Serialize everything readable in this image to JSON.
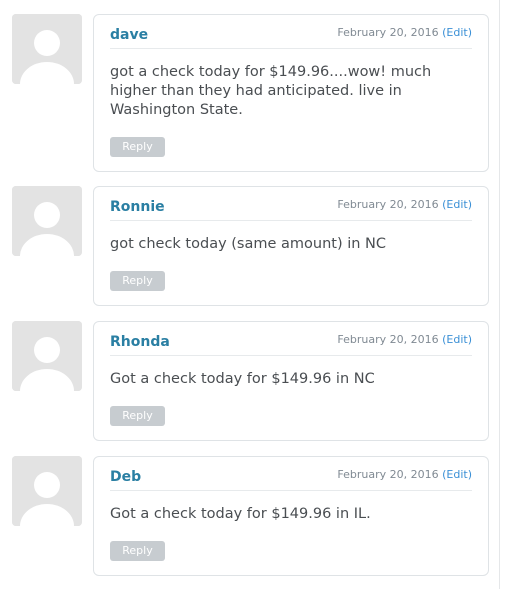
{
  "comments": [
    {
      "author": "dave",
      "date": "February 20, 2016",
      "edit_label": "(Edit)",
      "text": "got a check today for $149.96....wow! much higher than they had anticipated. live in Washington State.",
      "reply_label": "Reply",
      "avatar_icon": "default-avatar-icon"
    },
    {
      "author": "Ronnie",
      "date": "February 20, 2016",
      "edit_label": "(Edit)",
      "text": "got check today (same amount) in NC",
      "reply_label": "Reply",
      "avatar_icon": "default-avatar-icon"
    },
    {
      "author": "Rhonda",
      "date": "February 20, 2016",
      "edit_label": "(Edit)",
      "text": "Got a check today for $149.96 in NC",
      "reply_label": "Reply",
      "avatar_icon": "default-avatar-icon"
    },
    {
      "author": "Deb",
      "date": "February 20, 2016",
      "edit_label": "(Edit)",
      "text": "Got a check today for $149.96 in IL.",
      "reply_label": "Reply",
      "avatar_icon": "default-avatar-icon"
    }
  ],
  "colors": {
    "author_link": "#2a7fa3",
    "edit_link": "#3b90d6",
    "reply_button_bg": "#c7ccd0",
    "avatar_bg": "#e3e3e3"
  }
}
